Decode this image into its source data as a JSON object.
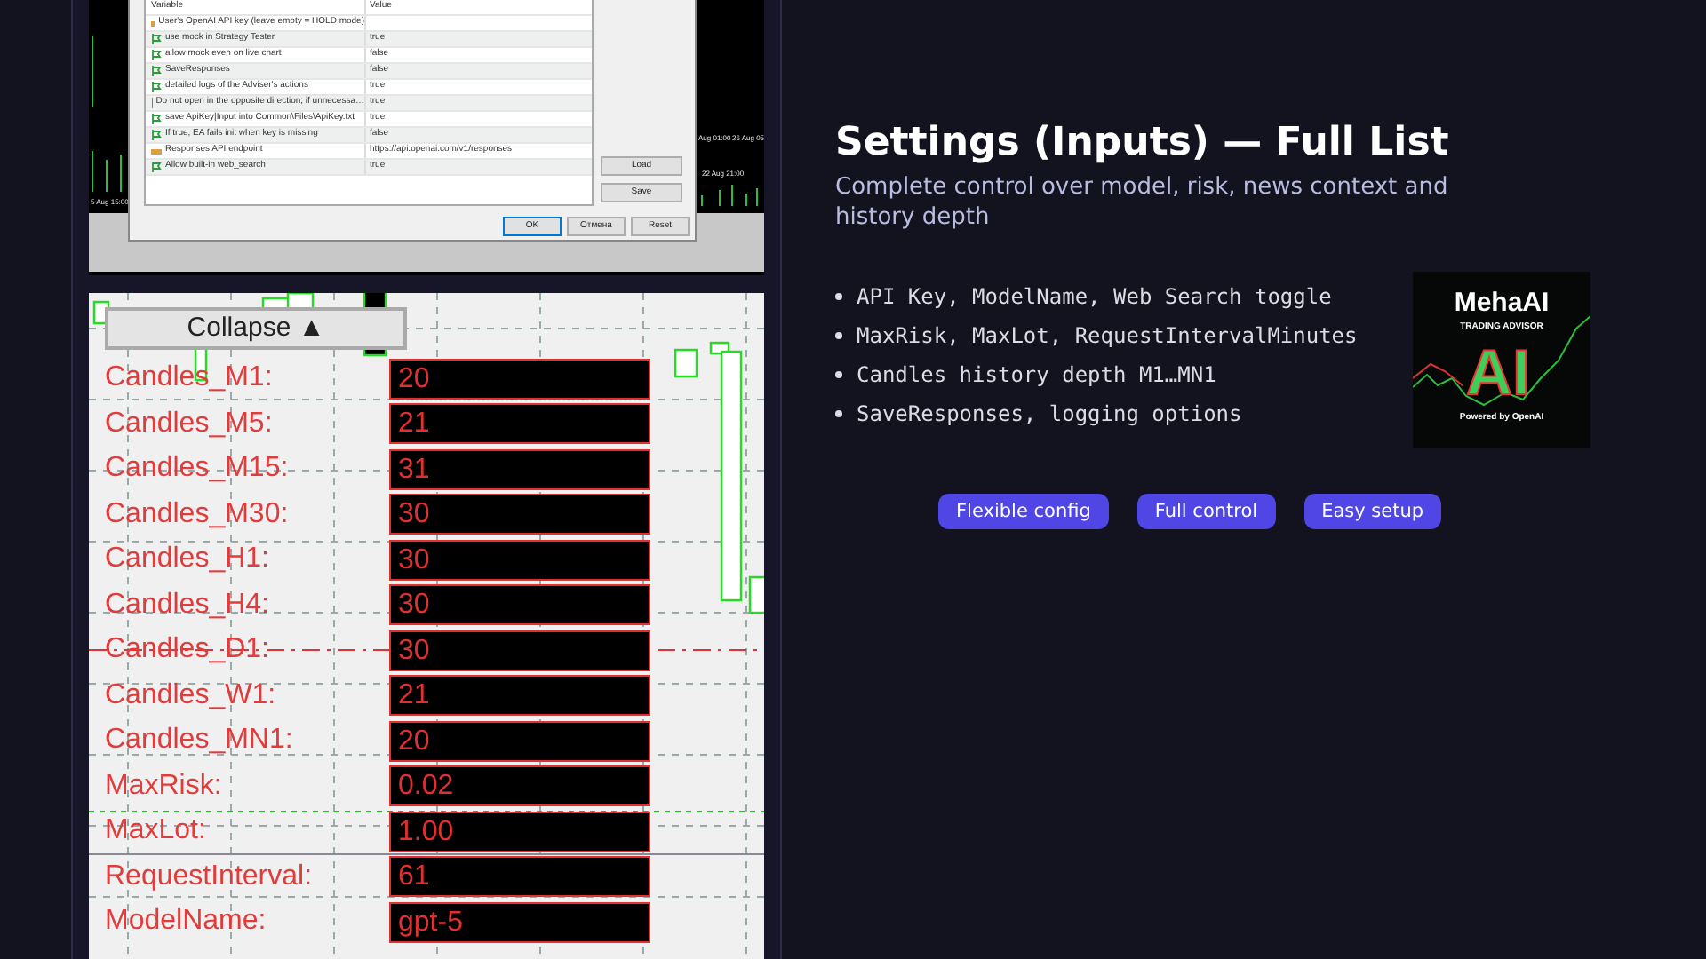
{
  "inputs_dialog": {
    "columns": [
      "Variable",
      "Value"
    ],
    "rows": [
      {
        "kind": "text",
        "variable": "User's OpenAI API key (leave empty = HOLD mode)",
        "value": ""
      },
      {
        "kind": "bool",
        "variable": "use mock in Strategy Tester",
        "value": "true"
      },
      {
        "kind": "bool",
        "variable": "allow mock even on live chart",
        "value": "false"
      },
      {
        "kind": "bool",
        "variable": "SaveResponses",
        "value": "false"
      },
      {
        "kind": "bool",
        "variable": "detailed logs of the Adviser's actions",
        "value": "true"
      },
      {
        "kind": "bool",
        "variable": "Do not open in the opposite direction; if unnecessa…",
        "value": "true"
      },
      {
        "kind": "bool",
        "variable": "save ApiKey|Input into Common\\Files\\ApiKey.txt",
        "value": "true"
      },
      {
        "kind": "bool",
        "variable": "If true, EA fails init when key is missing",
        "value": "false"
      },
      {
        "kind": "text",
        "variable": "Responses API endpoint",
        "value": "https://api.openai.com/v1/responses"
      },
      {
        "kind": "bool",
        "variable": "Allow built-in web_search",
        "value": "true"
      }
    ],
    "side_buttons": [
      "Load",
      "Save"
    ],
    "buttons": [
      {
        "label": "OK",
        "selected": true
      },
      {
        "label": "Отмена",
        "selected": false
      },
      {
        "label": "Reset",
        "selected": false
      }
    ],
    "chart_labels": [
      "Aug 01:00",
      "26 Aug 05",
      "22 Aug 21:00",
      "5 Aug 15:00"
    ]
  },
  "inputs_panel": {
    "collapse_button": "Collapse ▲",
    "fields": [
      {
        "label": "Candles_M1:",
        "value": "20"
      },
      {
        "label": "Candles_M5:",
        "value": "21"
      },
      {
        "label": "Candles_M15:",
        "value": "31"
      },
      {
        "label": "Candles_M30:",
        "value": "30"
      },
      {
        "label": "Candles_H1:",
        "value": "30"
      },
      {
        "label": "Candles_H4:",
        "value": "30"
      },
      {
        "label": "Candles_D1:",
        "value": "30"
      },
      {
        "label": "Candles_W1:",
        "value": "21"
      },
      {
        "label": "Candles_MN1:",
        "value": "20"
      },
      {
        "label": "MaxRisk:",
        "value": "0.02"
      },
      {
        "label": "MaxLot:",
        "value": "1.00"
      },
      {
        "label": "RequestInterval:",
        "value": "61"
      },
      {
        "label": "ModelName:",
        "value": "gpt-5"
      }
    ]
  },
  "title": "Settings (Inputs) — Full List",
  "subtitle": "Complete control over model, risk, news context and history depth",
  "features": [
    "API Key, ModelName, Web Search toggle",
    "MaxRisk, MaxLot, RequestIntervalMinutes",
    "Candles history depth M1…MN1",
    "SaveResponses, logging options"
  ],
  "logo": {
    "name": "MehaAI",
    "tagline": "TRADING ADVISOR",
    "mark": "AI",
    "footer": "Powered by OpenAI"
  },
  "tags": [
    "Flexible config",
    "Full control",
    "Easy setup"
  ]
}
